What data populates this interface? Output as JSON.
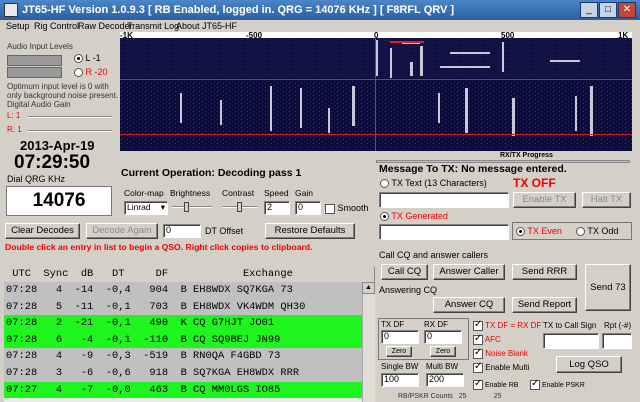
{
  "window": {
    "title": "JT65-HF Version 1.0.9.3  [ RB Enabled, logged in.  QRG = 14076 KHz ] [ F8RFL QRV ]",
    "minimize_label": "_",
    "maximize_label": "□",
    "close_label": "✕"
  },
  "menu": {
    "items": [
      "Setup",
      "Rig Control",
      "Raw Decoder",
      "Transmit Log",
      "About JT65-HF"
    ]
  },
  "audio": {
    "title": "Audio Input Levels",
    "left_label": "L -1",
    "right_label": "R -20",
    "hint_line1": "Optimum input level is 0 with",
    "hint_line2": "only background noise present.",
    "gain_label": "Digital Audio Gain",
    "gain_l_label": "L: 1",
    "gain_r_label": "R: 1"
  },
  "clock": {
    "date": "2013-Apr-19",
    "time": "07:29:50",
    "dial_label": "Dial QRG KHz",
    "dial_value": "14076"
  },
  "waterfall": {
    "ticks": [
      "-1K",
      "-500",
      "0",
      "500",
      "1K"
    ],
    "rxtx_label": "RX/TX Progress"
  },
  "operation": {
    "label": "Current Operation:",
    "value": "Decoding pass 1"
  },
  "controls": {
    "colormap_label": "Color-map",
    "colormap_value": "Linrad",
    "brightness_label": "Brightness",
    "contrast_label": "Contrast",
    "speed_label": "Speed",
    "speed_value": "2",
    "gain_label": "Gain",
    "gain_value": "0",
    "smooth_label": "Smooth"
  },
  "decode_buttons": {
    "clear": "Clear Decodes",
    "again": "Decode Again",
    "dt_value": "0",
    "dt_label": "DT Offset",
    "restore": "Restore Defaults"
  },
  "hint": "Double click an entry in list to begin a QSO.  Right click copies to clipboard.",
  "table": {
    "header": " UTC  Sync  dB   DT     DF            Exchange",
    "rows": [
      {
        "text": "07:28   4  -14  -0,4   904  B EH8WDX SQ7KGA 73",
        "style": "gray"
      },
      {
        "text": "07:28   5  -11  -0,1   703  B EH8WDX VK4WDM QH30",
        "style": "gray"
      },
      {
        "text": "07:28   2  -21  -0,1   490  K CQ G7HJT JO01",
        "style": "green"
      },
      {
        "text": "07:28   6   -4  -0,1  -110  B CQ SQ9BEJ JN99",
        "style": "green"
      },
      {
        "text": "07:28   4   -9  -0,3  -519  B RN0QA F4GBD 73",
        "style": "gray"
      },
      {
        "text": "07:28   3   -6  -0,6   918  B SQ7KGA EH8WDX RRR",
        "style": "gray"
      },
      {
        "text": "07:27   4   -7  -0,0   463  B CQ MM0LGS IO85",
        "style": "green"
      }
    ]
  },
  "message": {
    "title": "Message To TX:  No message entered.",
    "tx_text_label": "TX Text (13 Characters)",
    "tx_off": "TX OFF",
    "enable_tx": "Enable TX",
    "halt_tx": "Halt TX",
    "tx_generated": "TX Generated",
    "tx_even": "TX Even",
    "tx_odd": "TX Odd"
  },
  "qso": {
    "call_title": "Call CQ and answer callers",
    "call_cq": "Call CQ",
    "answer_caller": "Answer Caller",
    "send_rrr": "Send RRR",
    "send_73": "Send 73",
    "answering_title": "Answering CQ",
    "answer_cq": "Answer CQ",
    "send_report": "Send Report"
  },
  "settings": {
    "tx_df_label": "TX DF",
    "tx_df_value": "0",
    "rx_df_label": "RX DF",
    "rx_df_value": "0",
    "zero_label": "Zero",
    "txdf_eq_rxdf": "TX DF = RX DF",
    "afc": "AFC",
    "noise_blank": "Noise Blank",
    "tx_call_label": "TX to Call Sign",
    "rpt_label": "Rpt (-#)",
    "single_bw_label": "Single BW",
    "single_bw_value": "100",
    "multi_bw_label": "Multi BW",
    "multi_bw_value": "200",
    "enable_multi": "Enable Multi",
    "log_qso": "Log QSO",
    "enable_rb": "Enable RB",
    "enable_pskr": "Enable PSKR",
    "footer": "RB/PSKR Counts   25              25"
  },
  "colors": {
    "title_bar": "#2a5fa0",
    "green_row": "#1ef51e",
    "gray_row": "#c0c0c0",
    "red_text": "#e00000",
    "waterfall_bg": "#0a0a38"
  }
}
